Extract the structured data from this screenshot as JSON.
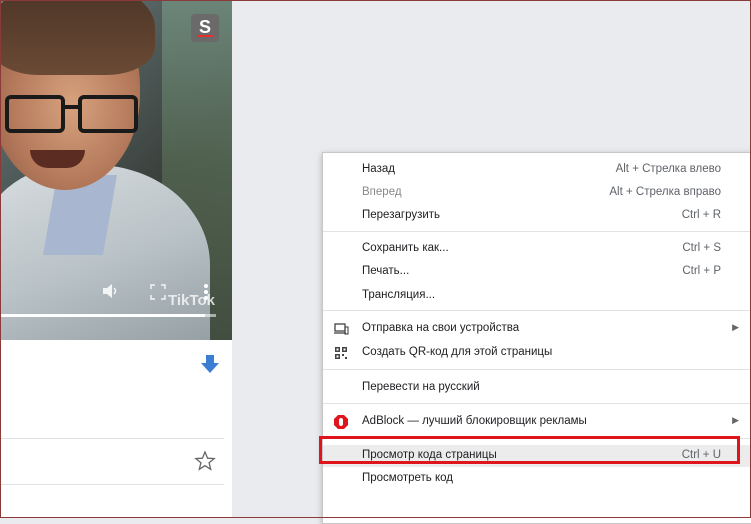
{
  "video": {
    "logo_letter": "S",
    "watermark": "TikTok",
    "progress": 0.95
  },
  "context_menu": {
    "groups": [
      {
        "items": [
          {
            "label": "Назад",
            "shortcut": "Alt + Стрелка влево",
            "enabled": true
          },
          {
            "label": "Вперед",
            "shortcut": "Alt + Стрелка вправо",
            "enabled": false
          },
          {
            "label": "Перезагрузить",
            "shortcut": "Ctrl + R",
            "enabled": true
          }
        ]
      },
      {
        "items": [
          {
            "label": "Сохранить как...",
            "shortcut": "Ctrl + S",
            "enabled": true
          },
          {
            "label": "Печать...",
            "shortcut": "Ctrl + P",
            "enabled": true
          },
          {
            "label": "Трансляция...",
            "shortcut": "",
            "enabled": true
          }
        ]
      },
      {
        "items": [
          {
            "label": "Отправка на свои устройства",
            "icon": "devices-icon",
            "submenu": true
          },
          {
            "label": "Создать QR-код для этой страницы",
            "icon": "qr-code-icon"
          }
        ]
      },
      {
        "items": [
          {
            "label": "Перевести на русский"
          }
        ]
      },
      {
        "items": [
          {
            "label": "AdBlock — лучший блокировщик рекламы",
            "icon": "adblock-icon",
            "submenu": true
          }
        ]
      },
      {
        "items": [
          {
            "label": "Просмотр кода страницы",
            "shortcut": "Ctrl + U",
            "highlighted": true
          },
          {
            "label": "Просмотреть код"
          }
        ]
      }
    ],
    "submenu_arrow": "▶"
  },
  "colors": {
    "highlight_border": "#e0141c",
    "adblock_red": "#e0141c",
    "download_blue": "#3b7fd4"
  }
}
